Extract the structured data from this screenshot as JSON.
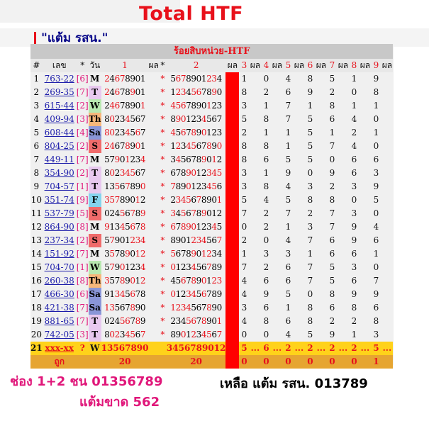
{
  "title": "Total HTF",
  "subtitle": "\"แต้ม รสน.\"",
  "table": {
    "caption": "ร้อยสิบหน่วย-HTF",
    "headers": [
      "#",
      "เลข",
      "*",
      "วัน",
      "1",
      "ผล",
      "*",
      "2",
      "ผล",
      "3",
      "ผล",
      "4",
      "ผล",
      "5",
      "ผล",
      "6",
      "ผล",
      "7",
      "ผล",
      "8",
      "ผล",
      "9",
      "ผล"
    ],
    "rows": [
      {
        "n": "1",
        "num": "763-22",
        "br": "[6]",
        "day": "M",
        "d1": "24678901",
        "d2": "5678901234",
        "r": [
          "1",
          "0",
          "4",
          "8",
          "5",
          "1",
          "9"
        ]
      },
      {
        "n": "2",
        "num": "269-35",
        "br": "[7]",
        "day": "T",
        "d1": "24678901",
        "d2": "1234567890",
        "r": [
          "8",
          "2",
          "6",
          "9",
          "2",
          "0",
          "8"
        ]
      },
      {
        "n": "3",
        "num": "615-44",
        "br": "[2]",
        "day": "W",
        "d1": "24678901",
        "d2": "4567890123",
        "r": [
          "3",
          "1",
          "7",
          "1",
          "8",
          "1",
          "1"
        ]
      },
      {
        "n": "4",
        "num": "409-94",
        "br": "[3]",
        "day": "Th",
        "d1": "80234567",
        "d2": "8901234567",
        "r": [
          "5",
          "8",
          "7",
          "5",
          "6",
          "4",
          "0"
        ]
      },
      {
        "n": "5",
        "num": "608-44",
        "br": "[4]",
        "day": "Sa",
        "d1": "80234567",
        "d2": "4567890123",
        "r": [
          "2",
          "1",
          "1",
          "5",
          "1",
          "2",
          "1"
        ]
      },
      {
        "n": "6",
        "num": "804-25",
        "br": "[2]",
        "day": "S",
        "d1": "24678901",
        "d2": "1234567890",
        "r": [
          "8",
          "8",
          "1",
          "5",
          "7",
          "4",
          "0"
        ]
      },
      {
        "n": "7",
        "num": "449-11",
        "br": "[7]",
        "day": "M",
        "d1": "57901234",
        "d2": "3456789012",
        "r": [
          "8",
          "6",
          "5",
          "5",
          "0",
          "6",
          "6"
        ]
      },
      {
        "n": "8",
        "num": "354-90",
        "br": "[2]",
        "day": "T",
        "d1": "80234567",
        "d2": "6789012345",
        "r": [
          "3",
          "1",
          "9",
          "0",
          "9",
          "6",
          "3"
        ]
      },
      {
        "n": "9",
        "num": "704-57",
        "br": "[1]",
        "day": "T",
        "d1": "13567890",
        "d2": "7890123456",
        "r": [
          "3",
          "8",
          "4",
          "3",
          "2",
          "3",
          "9"
        ]
      },
      {
        "n": "10",
        "num": "351-74",
        "br": "[9]",
        "day": "F",
        "d1": "35789012",
        "d2": "2345678901",
        "r": [
          "5",
          "4",
          "5",
          "8",
          "8",
          "0",
          "5"
        ]
      },
      {
        "n": "11",
        "num": "537-79",
        "br": "[5]",
        "day": "S",
        "d1": "02456789",
        "d2": "3456789012",
        "r": [
          "7",
          "2",
          "7",
          "2",
          "7",
          "3",
          "0"
        ]
      },
      {
        "n": "12",
        "num": "864-90",
        "br": "[8]",
        "day": "M",
        "d1": "91345678",
        "d2": "6789012345",
        "r": [
          "0",
          "2",
          "1",
          "3",
          "7",
          "9",
          "4"
        ]
      },
      {
        "n": "13",
        "num": "237-34",
        "br": "[2]",
        "day": "S",
        "d1": "57901234",
        "d2": "8901234567",
        "r": [
          "2",
          "0",
          "4",
          "7",
          "6",
          "9",
          "6"
        ]
      },
      {
        "n": "14",
        "num": "151-92",
        "br": "[7]",
        "day": "M",
        "d1": "35789012",
        "d2": "5678901234",
        "r": [
          "1",
          "3",
          "3",
          "1",
          "6",
          "6",
          "1"
        ]
      },
      {
        "n": "15",
        "num": "704-70",
        "br": "[1]",
        "day": "W",
        "d1": "57901234",
        "d2": "0123456789",
        "r": [
          "7",
          "2",
          "6",
          "7",
          "5",
          "3",
          "0"
        ]
      },
      {
        "n": "16",
        "num": "260-38",
        "br": "[8]",
        "day": "Th",
        "d1": "35789012",
        "d2": "4567890123",
        "r": [
          "4",
          "6",
          "6",
          "7",
          "5",
          "6",
          "7"
        ]
      },
      {
        "n": "17",
        "num": "466-30",
        "br": "[6]",
        "day": "Sa",
        "d1": "91345678",
        "d2": "0123456789",
        "r": [
          "4",
          "9",
          "5",
          "0",
          "8",
          "9",
          "9"
        ]
      },
      {
        "n": "18",
        "num": "421-38",
        "br": "[7]",
        "day": "Sa",
        "d1": "13567890",
        "d2": "1234567890",
        "r": [
          "3",
          "6",
          "1",
          "8",
          "6",
          "8",
          "6"
        ]
      },
      {
        "n": "19",
        "num": "881-65",
        "br": "[7]",
        "day": "T",
        "d1": "02456789",
        "d2": "2345678901",
        "r": [
          "4",
          "8",
          "6",
          "8",
          "2",
          "2",
          "8"
        ]
      },
      {
        "n": "20",
        "num": "742-05",
        "br": "[3]",
        "day": "T",
        "d1": "80234567",
        "d2": "8901234567",
        "r": [
          "0",
          "0",
          "4",
          "5",
          "9",
          "1",
          "3"
        ]
      }
    ],
    "row21": {
      "n": "21",
      "num": "xxx-xx",
      "br": "?",
      "day": "W",
      "d1": "13567890",
      "d2": "3456789012",
      "r": [
        "5",
        "6",
        "2",
        "2",
        "2",
        "2",
        "5"
      ],
      "dots": "..."
    },
    "ok_row": {
      "label": "ถูก",
      "c1": "20",
      "c2": "20",
      "r": [
        "0",
        "0",
        "0",
        "0",
        "0",
        "0",
        "1"
      ]
    }
  },
  "bottom": {
    "line1": "ช่อง 1+2 ชน 01356789",
    "line2": "แต้มขาด 562",
    "right_label": "เหลือ แต้ม รสน.",
    "right_value": "013789"
  },
  "colors": {
    "accent_red": "#e8111b",
    "pink": "#e0177a",
    "blue": "#1b1baa",
    "yellow": "#ffd21a",
    "orange": "#e6a531"
  }
}
